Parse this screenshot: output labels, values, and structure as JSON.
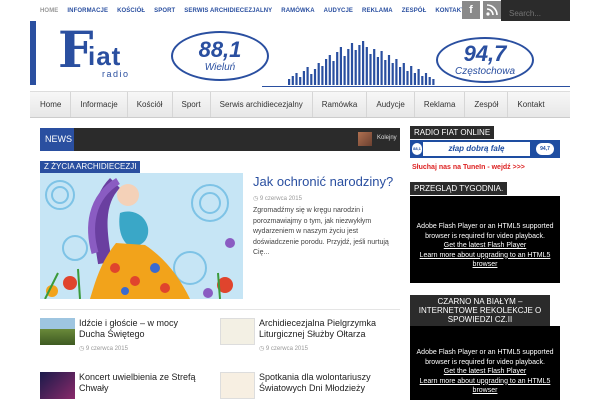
{
  "topbar": {
    "nav": [
      "HOME",
      "INFORMACJE",
      "KOŚCIÓŁ",
      "SPORT",
      "SERWIS ARCHIDIECEZJALNY",
      "RAMÓWKA",
      "AUDYCJE",
      "REKLAMA",
      "ZESPÓŁ",
      "KONTAKT"
    ],
    "search_placeholder": "Search...",
    "social_icons": [
      "facebook-icon",
      "rss-icon"
    ],
    "social_glyphs": [
      "f",
      "▸"
    ]
  },
  "header": {
    "logo_f": "F",
    "logo_iat": "iat",
    "logo_radio": "radio",
    "freq1": {
      "num": "88,1",
      "city": "Wieluń"
    },
    "freq2": {
      "num": "94,7",
      "city": "Częstochowa"
    }
  },
  "mainnav": [
    "Home",
    "Informacje",
    "Kościół",
    "Sport",
    "Serwis archidiecezjalny",
    "Ramówka",
    "Audycje",
    "Reklama",
    "Zespół",
    "Kontakt"
  ],
  "ticker": {
    "label": "NEWS",
    "next": "Kolejny"
  },
  "featured": {
    "category": "Z ŻYCIA ARCHIDIECEZJI",
    "title": "Jak ochronić narodziny?",
    "date": "9 czerwca 2015",
    "excerpt": "Zgromadźmy się w kręgu narodzin i porozmawiajmy o tym, jak niezwykłym wydarzeniem w naszym życiu jest doświadczenie porodu. Przyjdź, jeśli nurtują Cię..."
  },
  "posts": [
    {
      "title": "Idźcie i głoście – w mocy Ducha Świętego",
      "date": "9 czerwca 2015"
    },
    {
      "title": "Archidiecezjalna Pielgrzymka Liturgicznej Służby Ołtarza",
      "date": "9 czerwca 2015"
    },
    {
      "title": "Koncert uwielbienia ze Strefą Chwały",
      "date": ""
    },
    {
      "title": "Spotkania dla wolontariuszy Światowych Dni Młodzieży",
      "date": ""
    }
  ],
  "sidebar": {
    "radio_title": "RADIO FIAT ONLINE",
    "banner_text": "złap dobrą falę",
    "banner_logo": "94,7",
    "banner_logo_left": "88,1",
    "listen_link": "Słuchaj nas na TuneIn - wejdź >>>",
    "review_title": "PRZEGLĄD TYGODNIA.",
    "flash_msg": "Adobe Flash Player or an HTML5 supported browser is required for video playback.",
    "flash_get": "Get the latest Flash Player",
    "flash_learn": "Learn more about upgrading to an HTML5 browser",
    "retreat_title": "CZARNO NA BIAŁYM – INTERNETOWE REKOLEKCJE O SPOWIEDZI CZ.II"
  },
  "colors": {
    "brand": "#2a4fa0",
    "dark": "#2b2b2b",
    "link_red": "#dd2222"
  }
}
